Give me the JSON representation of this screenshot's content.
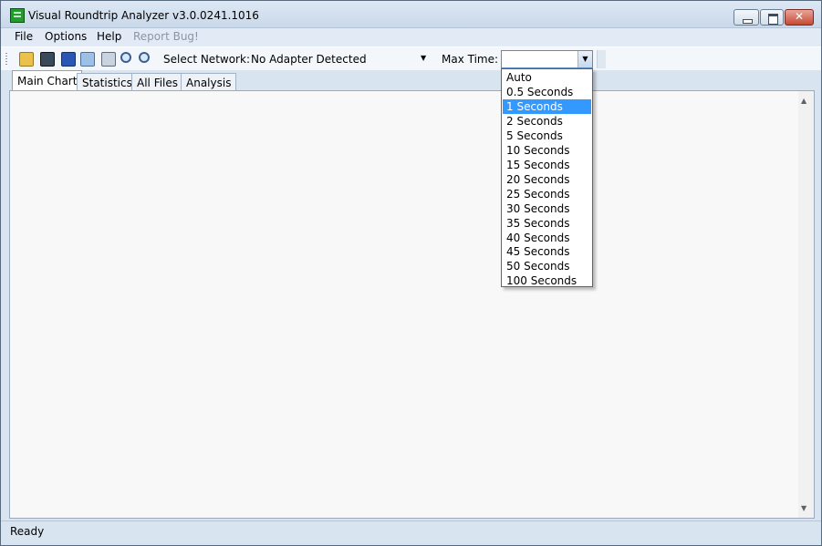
{
  "window": {
    "title": "Visual Roundtrip Analyzer v3.0.0241.1016"
  },
  "menu": [
    {
      "label": "File",
      "enabled": true
    },
    {
      "label": "Options",
      "enabled": true
    },
    {
      "label": "Help",
      "enabled": true
    },
    {
      "label": "Report Bug!",
      "enabled": false
    }
  ],
  "toolbar": {
    "icons": [
      "open-folder-icon",
      "capture-icon",
      "save-icon",
      "copy-icon",
      "print-icon",
      "zoom-in-icon",
      "zoom-out-icon"
    ],
    "network_label": "Select Network:",
    "network_value": "No Adapter Detected",
    "max_time_label": "Max Time:",
    "max_time_value": ""
  },
  "tabs": [
    {
      "label": "Main Chart",
      "active": true
    },
    {
      "label": "Statistics",
      "active": false
    },
    {
      "label": "All Files",
      "active": false
    },
    {
      "label": "Analysis",
      "active": false
    }
  ],
  "max_time_options": {
    "items": [
      "Auto",
      "0.5 Seconds",
      "1 Seconds",
      "2 Seconds",
      "5 Seconds",
      "10 Seconds",
      "15 Seconds",
      "20 Seconds",
      "25 Seconds",
      "30 Seconds",
      "35 Seconds",
      "40 Seconds",
      "45 Seconds",
      "50 Seconds",
      "100 Seconds"
    ],
    "highlighted": "1 Seconds"
  },
  "status": {
    "text": "Ready"
  },
  "colors": {
    "selection": "#3399ff",
    "window_frame": "#d9e4f1"
  }
}
